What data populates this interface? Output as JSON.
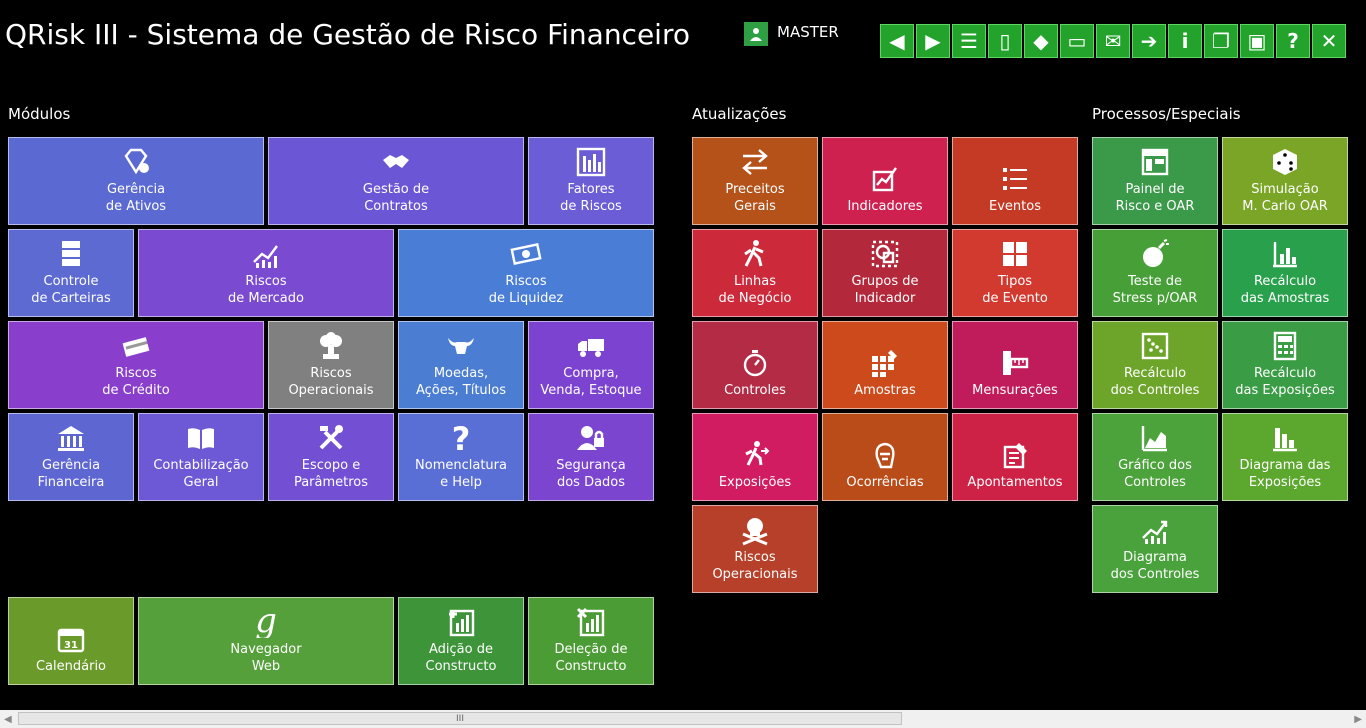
{
  "header": {
    "title": "QRisk III - Sistema de Gestão de Risco Financeiro",
    "user": "MASTER"
  },
  "toolbar": [
    {
      "name": "back-button",
      "icon": "arrow-left-icon",
      "glyph": "◀"
    },
    {
      "name": "forward-button",
      "icon": "arrow-right-icon",
      "glyph": "▶"
    },
    {
      "name": "filter-button",
      "icon": "traffic-light-icon",
      "glyph": "☰"
    },
    {
      "name": "columns-button",
      "icon": "column-icon",
      "glyph": "▯"
    },
    {
      "name": "paint-button",
      "icon": "paint-bucket-icon",
      "glyph": "◆"
    },
    {
      "name": "monitor-button",
      "icon": "monitor-icon",
      "glyph": "▭"
    },
    {
      "name": "mail-button",
      "icon": "envelope-icon",
      "glyph": "✉"
    },
    {
      "name": "send-button",
      "icon": "send-icon",
      "glyph": "➔"
    },
    {
      "name": "info-button",
      "icon": "info-icon",
      "glyph": "i"
    },
    {
      "name": "document-button",
      "icon": "document-gear-icon",
      "glyph": "❐"
    },
    {
      "name": "exit-door-button",
      "icon": "door-icon",
      "glyph": "▣"
    },
    {
      "name": "help-button",
      "icon": "question-icon",
      "glyph": "?"
    },
    {
      "name": "close-button",
      "icon": "close-icon",
      "glyph": "✕"
    }
  ],
  "sections": {
    "modulos": "Módulos",
    "atualizacoes": "Atualizações",
    "processos": "Processos/Especiais"
  },
  "tiles": {
    "modulos": [
      {
        "label": "Gerência\nde Ativos",
        "icon": "diamond-icon",
        "color": "#5b6ad3"
      },
      {
        "label": "Gestão de\nContratos",
        "icon": "handshake-icon",
        "color": "#6b56d6"
      },
      {
        "label": "Fatores\nde  Riscos",
        "icon": "bar-chart-icon",
        "color": "#6a5dd6"
      },
      {
        "label": "Controle\nde Carteiras",
        "icon": "cabinet-icon",
        "color": "#5d6ad2"
      },
      {
        "label": "Riscos\nde  Mercado",
        "icon": "line-chart-icon",
        "color": "#7a4bd1"
      },
      {
        "label": "Riscos\nde Liquidez",
        "icon": "money-icon",
        "color": "#4a7ed6"
      },
      {
        "label": "Riscos\nde  Crédito",
        "icon": "credit-card-icon",
        "color": "#8a3fcc"
      },
      {
        "label": "Riscos\nOperacionais",
        "icon": "explosion-icon",
        "color": "#808080"
      },
      {
        "label": "Moedas,\nAções, Títulos",
        "icon": "bull-icon",
        "color": "#4b7ed2"
      },
      {
        "label": "Compra,\nVenda, Estoque",
        "icon": "truck-icon",
        "color": "#7c43d1"
      },
      {
        "label": "Gerência\nFinanceira",
        "icon": "bank-icon",
        "color": "#5e66d2"
      },
      {
        "label": "Contabilização\nGeral",
        "icon": "book-icon",
        "color": "#6d58d5"
      },
      {
        "label": "Escopo e\nParâmetros",
        "icon": "tools-icon",
        "color": "#7350d3"
      },
      {
        "label": "Nomenclatura\ne Help",
        "icon": "question-icon",
        "color": "#5a6fd5"
      },
      {
        "label": "Segurança\ndos Dados",
        "icon": "user-lock-icon",
        "color": "#7b45d0"
      },
      {
        "label": "Calendário",
        "icon": "calendar-icon",
        "color": "#6a9a2a"
      },
      {
        "label": "Navegador\nWeb",
        "icon": "google-icon",
        "color": "#55a03a"
      },
      {
        "label": "Adição de\nConstructo",
        "icon": "add-chart-icon",
        "color": "#3e9438"
      },
      {
        "label": "Deleção de\nConstructo",
        "icon": "delete-chart-icon",
        "color": "#4c9c35"
      }
    ],
    "atualizacoes": [
      {
        "label": "Preceitos\nGerais",
        "icon": "arrows-icon",
        "color": "#b4521a"
      },
      {
        "label": "Indicadores",
        "icon": "indicator-icon",
        "color": "#cf2150"
      },
      {
        "label": "Eventos",
        "icon": "list-icon",
        "color": "#c53a24"
      },
      {
        "label": "Linhas\nde Negócio",
        "icon": "walker-icon",
        "color": "#cc2a3b"
      },
      {
        "label": "Grupos de\nIndicador",
        "icon": "shapes-icon",
        "color": "#b3283a"
      },
      {
        "label": "Tipos\nde Evento",
        "icon": "grid-icon",
        "color": "#d23a2f"
      },
      {
        "label": "Controles",
        "icon": "stopwatch-icon",
        "color": "#b42b46"
      },
      {
        "label": "Amostras",
        "icon": "sample-grid-icon",
        "color": "#cc4a1c"
      },
      {
        "label": "Mensurações",
        "icon": "ruler-icon",
        "color": "#c01c5c"
      },
      {
        "label": "Exposições",
        "icon": "exit-run-icon",
        "color": "#d11c62"
      },
      {
        "label": "Ocorrências",
        "icon": "head-icon",
        "color": "#b94c18"
      },
      {
        "label": "Apontamentos",
        "icon": "note-pen-icon",
        "color": "#cd2146"
      },
      {
        "label": "Riscos\nOperacionais",
        "icon": "skull-icon",
        "color": "#b6402a"
      }
    ],
    "processos": [
      {
        "label": "Painel de\nRisco e OAR",
        "icon": "panel-icon",
        "color": "#3b9a49"
      },
      {
        "label": "Simulação\nM. Carlo OAR",
        "icon": "dice-icon",
        "color": "#7aa526"
      },
      {
        "label": "Teste de\nStress p/OAR",
        "icon": "bomb-icon",
        "color": "#47a037"
      },
      {
        "label": "Recálculo\ndas Amostras",
        "icon": "axis-chart-icon",
        "color": "#29a04c"
      },
      {
        "label": "Recálculo\ndos Controles",
        "icon": "scatter-icon",
        "color": "#6da52a"
      },
      {
        "label": "Recálculo\ndas Exposições",
        "icon": "calculator-icon",
        "color": "#3a9c44"
      },
      {
        "label": "Gráfico dos\nControles",
        "icon": "area-chart-icon",
        "color": "#4da33b"
      },
      {
        "label": "Diagrama das\nExposições",
        "icon": "diagram-icon",
        "color": "#5ca72e"
      },
      {
        "label": "Diagrama\ndos Controles",
        "icon": "growth-chart-icon",
        "color": "#4aa23d"
      }
    ]
  },
  "scrollbar": {
    "grip": "III"
  }
}
